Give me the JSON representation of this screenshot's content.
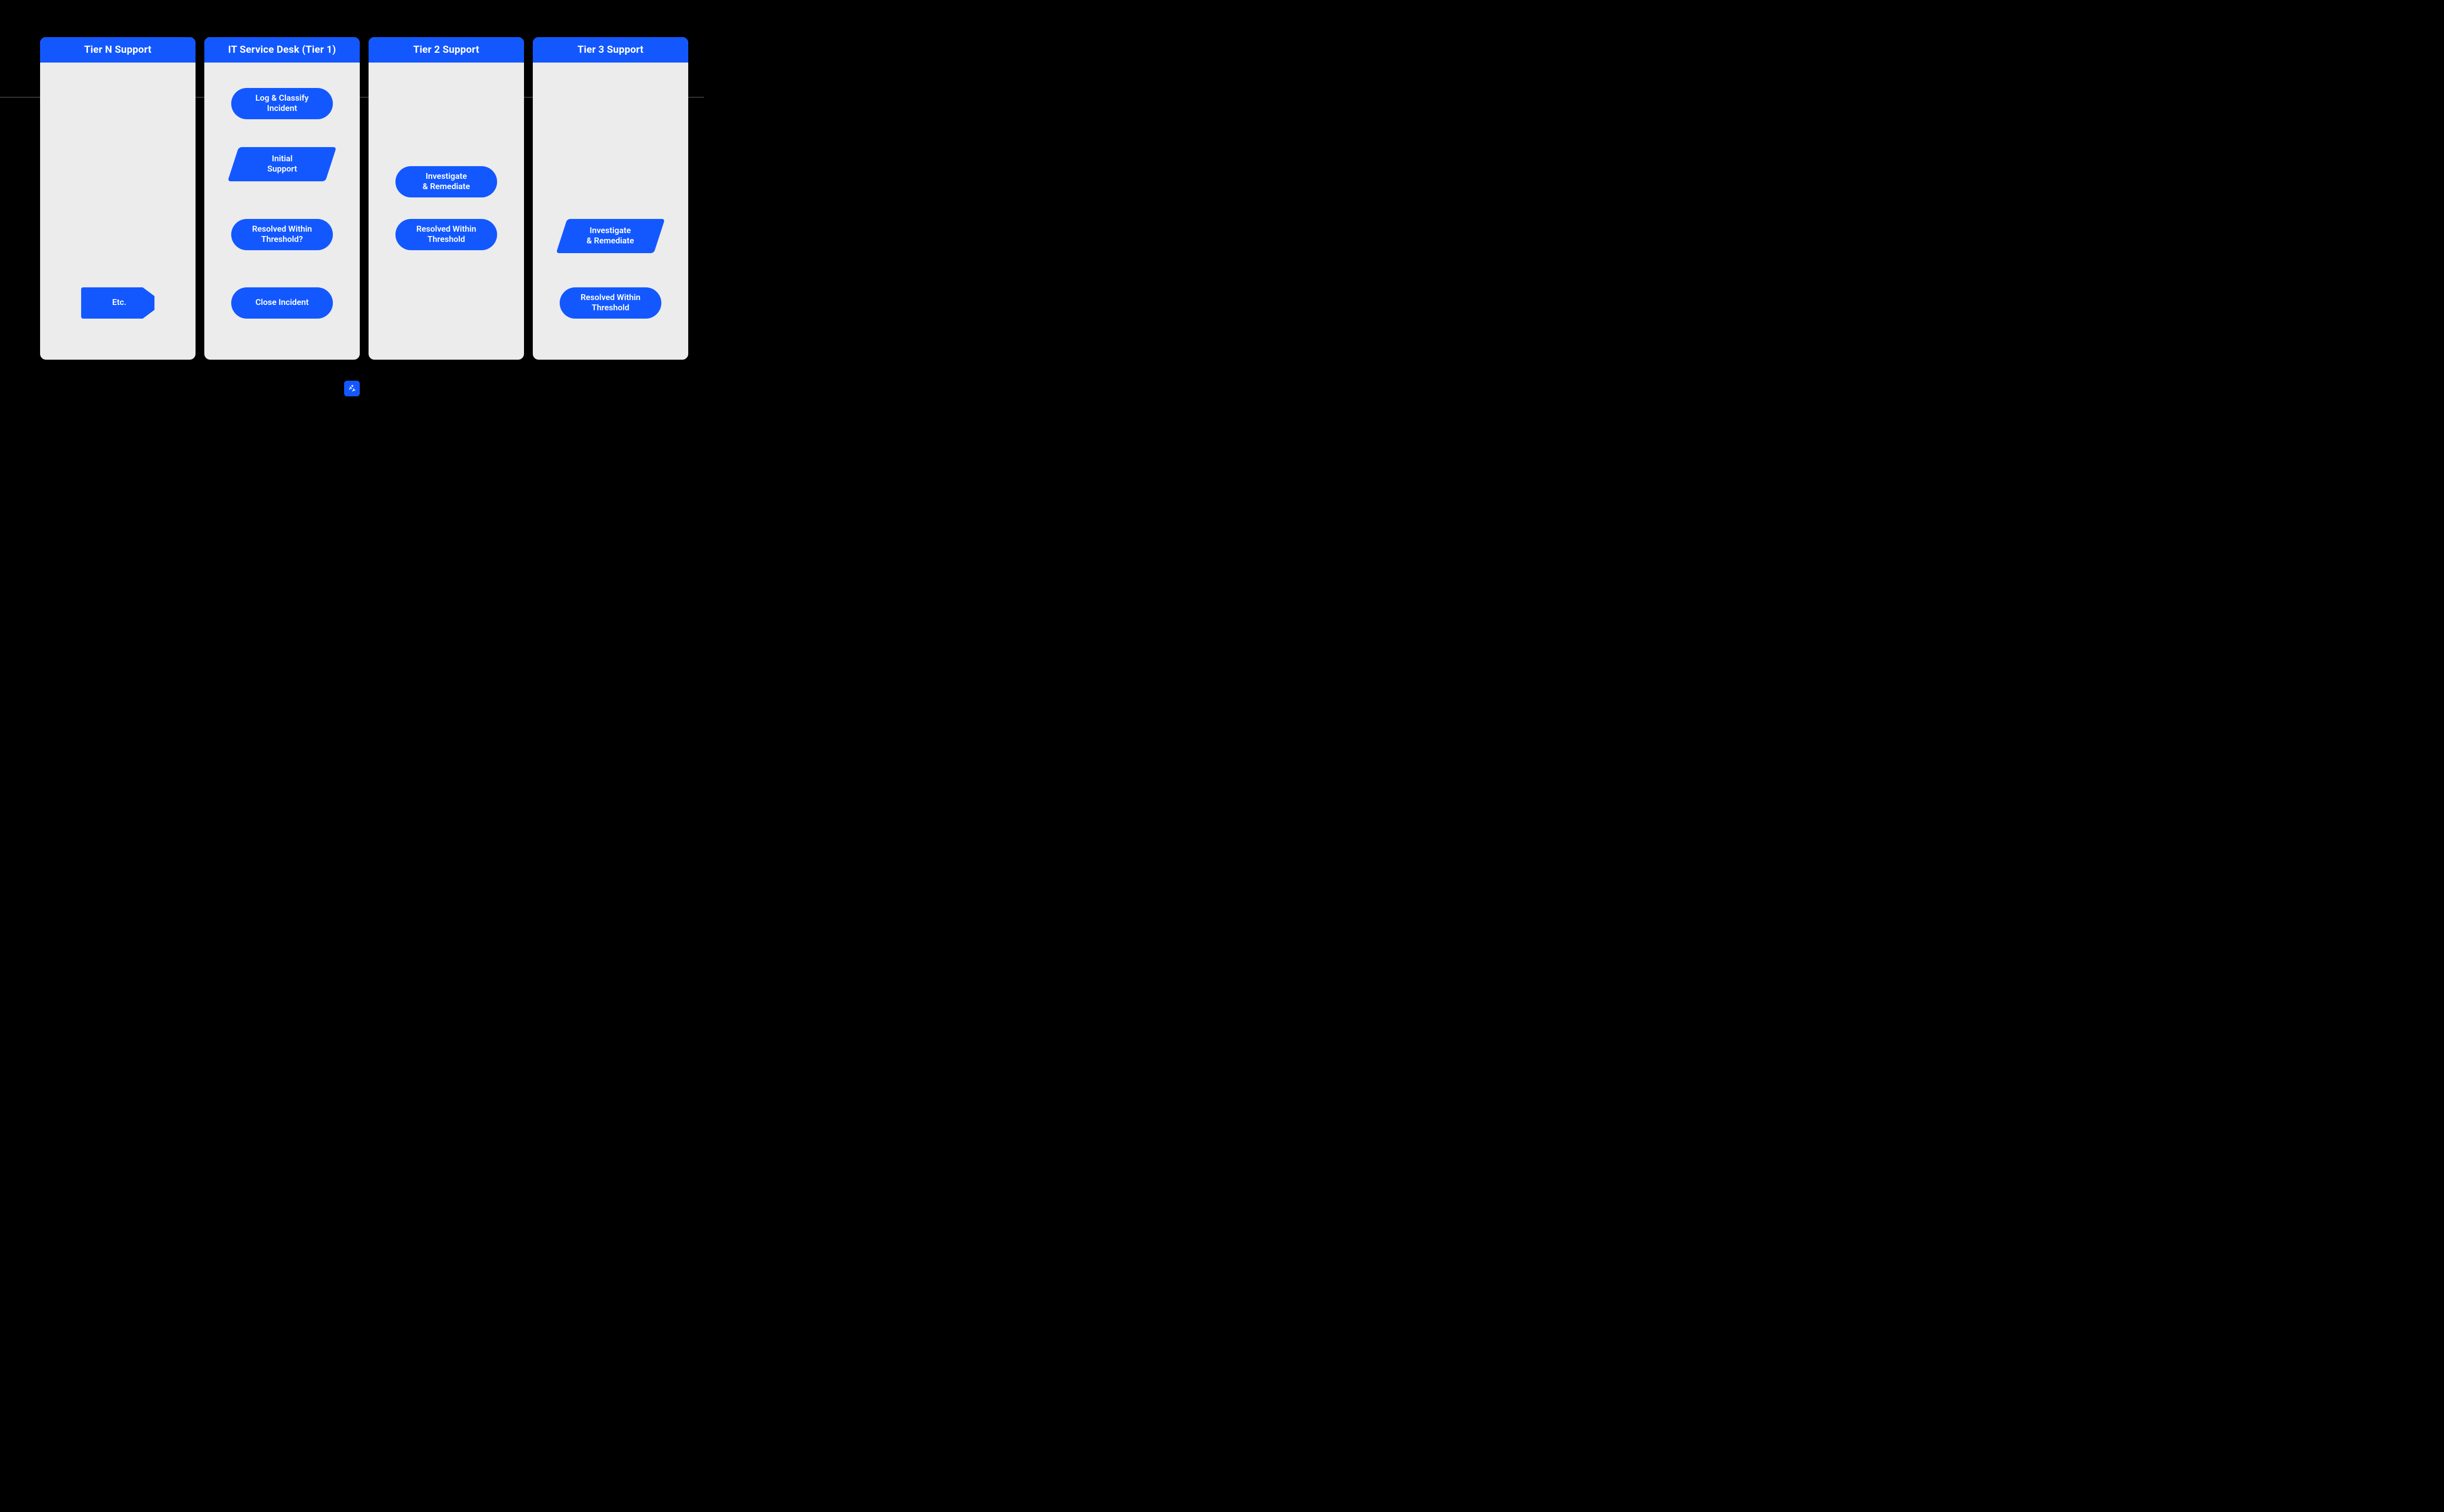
{
  "colors": {
    "accent": "#1358ff",
    "lane_bg": "#ececec",
    "page_bg": "#000000"
  },
  "lanes": [
    {
      "title": "IT Service Desk (Tier 1)"
    },
    {
      "title": "Tier 2 Support"
    },
    {
      "title": "Tier 3 Support"
    },
    {
      "title": "Tier N Support"
    }
  ],
  "nodes": {
    "t1_log": {
      "line1": "Log & Classify",
      "line2": "Incident"
    },
    "t1_initial": {
      "line1": "Initial",
      "line2": "Support"
    },
    "t1_resolved": {
      "line1": "Resolved Within",
      "line2": "Threshold?"
    },
    "t1_close": {
      "line1": "Close Incident"
    },
    "t2_inv": {
      "line1": "Investigate",
      "line2": "& Remediate"
    },
    "t2_resolved": {
      "line1": "Resolved Within",
      "line2": "Threshold"
    },
    "t3_inv": {
      "line1": "Investigate",
      "line2": "& Remediate"
    },
    "t3_resolved": {
      "line1": "Resolved Within",
      "line2": "Threshold"
    },
    "tN_etc": {
      "line1": "Etc."
    }
  },
  "badge_icon": "sparkle-icon"
}
